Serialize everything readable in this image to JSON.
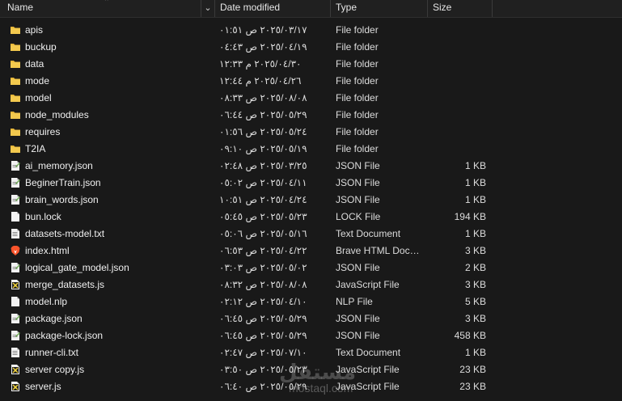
{
  "header": {
    "name": "Name",
    "date": "Date modified",
    "type": "Type",
    "size": "Size"
  },
  "rows": [
    {
      "name": "apis",
      "date": "٢٠٢٥/٠٣/١٧ ص ٠١:٥١",
      "type": "File folder",
      "size": "",
      "icon": "folder-icon"
    },
    {
      "name": "buckup",
      "date": "٢٠٢٥/٠٤/١٩ ص ٠٤:٤٣",
      "type": "File folder",
      "size": "",
      "icon": "folder-icon"
    },
    {
      "name": "data",
      "date": "٢٠٢٥/٠٤/٣٠ م ١٢:٣٣",
      "type": "File folder",
      "size": "",
      "icon": "folder-icon"
    },
    {
      "name": "mode",
      "date": "٢٠٢٥/٠٤/٢٦ م ١٢:٤٤",
      "type": "File folder",
      "size": "",
      "icon": "folder-icon"
    },
    {
      "name": "model",
      "date": "٢٠٢٥/٠٨/٠٨ ص ٠٨:٣٣",
      "type": "File folder",
      "size": "",
      "icon": "folder-icon"
    },
    {
      "name": "node_modules",
      "date": "٢٠٢٥/٠٥/٢٩ ص ٠٦:٤٤",
      "type": "File folder",
      "size": "",
      "icon": "folder-icon"
    },
    {
      "name": "requires",
      "date": "٢٠٢٥/٠٥/٢٤ ص ٠١:٥٦",
      "type": "File folder",
      "size": "",
      "icon": "folder-icon"
    },
    {
      "name": "T2IA",
      "date": "٢٠٢٥/٠٥/١٩ ص ٠٩:١٠",
      "type": "File folder",
      "size": "",
      "icon": "folder-icon"
    },
    {
      "name": "ai_memory.json",
      "date": "٢٠٢٥/٠٣/٢٥ ص ٠٢:٤٨",
      "type": "JSON File",
      "size": "1 KB",
      "icon": "json-file-icon"
    },
    {
      "name": "BeginerTrain.json",
      "date": "٢٠٢٥/٠٤/١١ ص ٠٥:٠٢",
      "type": "JSON File",
      "size": "1 KB",
      "icon": "json-file-icon"
    },
    {
      "name": "brain_words.json",
      "date": "٢٠٢٥/٠٤/٢٤ ص ١٠:٥١",
      "type": "JSON File",
      "size": "1 KB",
      "icon": "json-file-icon"
    },
    {
      "name": "bun.lock",
      "date": "٢٠٢٥/٠٥/٢٣ ص ٠٥:٤٥",
      "type": "LOCK File",
      "size": "194 KB",
      "icon": "blank-file-icon"
    },
    {
      "name": "datasets-model.txt",
      "date": "٢٠٢٥/٠٥/١٦ ص ٠٥:٠٦",
      "type": "Text Document",
      "size": "1 KB",
      "icon": "text-file-icon"
    },
    {
      "name": "index.html",
      "date": "٢٠٢٥/٠٤/٢٢ ص ٠٦:٥٣",
      "type": "Brave HTML Docu...",
      "size": "3 KB",
      "icon": "brave-html-icon"
    },
    {
      "name": "logical_gate_model.json",
      "date": "٢٠٢٥/٠٥/٠٢ ص ٠٣:٠٣",
      "type": "JSON File",
      "size": "2 KB",
      "icon": "json-file-icon"
    },
    {
      "name": "merge_datasets.js",
      "date": "٢٠٢٥/٠٨/٠٨ ص ٠٨:٣٢",
      "type": "JavaScript File",
      "size": "3 KB",
      "icon": "js-file-icon"
    },
    {
      "name": "model.nlp",
      "date": "٢٠٢٥/٠٤/١٠ ص ٠٢:١٢",
      "type": "NLP File",
      "size": "5 KB",
      "icon": "blank-file-icon"
    },
    {
      "name": "package.json",
      "date": "٢٠٢٥/٠٥/٢٩ ص ٠٦:٤٥",
      "type": "JSON File",
      "size": "3 KB",
      "icon": "json-file-icon"
    },
    {
      "name": "package-lock.json",
      "date": "٢٠٢٥/٠٥/٢٩ ص ٠٦:٤٥",
      "type": "JSON File",
      "size": "458 KB",
      "icon": "json-file-icon"
    },
    {
      "name": "runner-cli.txt",
      "date": "٢٠٢٥/٠٧/١٠ ص ٠٢:٤٧",
      "type": "Text Document",
      "size": "1 KB",
      "icon": "text-file-icon"
    },
    {
      "name": "server copy.js",
      "date": "٢٠٢٥/٠٥/٢٣ ص ٠٣:٥٠",
      "type": "JavaScript File",
      "size": "23 KB",
      "icon": "js-file-icon"
    },
    {
      "name": "server.js",
      "date": "٢٠٢٥/٠٥/٢٩ ص ٠٦:٤٠",
      "type": "JavaScript File",
      "size": "23 KB",
      "icon": "js-file-icon"
    }
  ],
  "watermark": {
    "arabic": "مستقل",
    "latin": "mostaql.com"
  },
  "colors": {
    "background": "#191919",
    "header": "#202020",
    "folder": "#e8b83a",
    "text": "#e6e6e6"
  }
}
